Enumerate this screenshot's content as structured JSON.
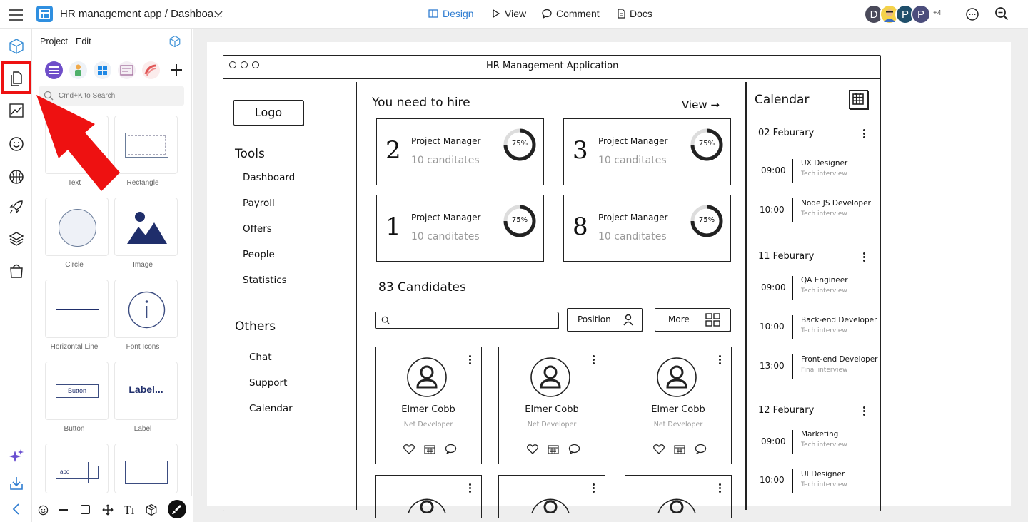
{
  "topbar": {
    "title": "HR management app / Dashboa...",
    "nav": {
      "design": "Design",
      "view": "View",
      "comment": "Comment",
      "docs": "Docs"
    },
    "avatars": [
      "D",
      "P",
      "P"
    ],
    "avatar_more": "+4",
    "accent": "#2f7dd1"
  },
  "panel": {
    "menu": {
      "project": "Project",
      "edit": "Edit"
    },
    "search_placeholder": "Cmd+K to Search",
    "tiles": [
      "Text",
      "Rectangle",
      "Circle",
      "Image",
      "Horizontal Line",
      "Font Icons",
      "Button",
      "Label"
    ],
    "button_preview": "Button",
    "label_preview": "Label...",
    "input_preview": "abc"
  },
  "mockup": {
    "window_title": "HR Management Application",
    "logo": "Logo",
    "tools_heading": "Tools",
    "tools": [
      "Dashboard",
      "Payroll",
      "Offers",
      "People",
      "Statistics"
    ],
    "others_heading": "Others",
    "others": [
      "Chat",
      "Support",
      "Calendar"
    ],
    "hire_heading": "You need to hire",
    "view_link": "View →",
    "hire_cards": [
      {
        "count": "2",
        "role": "Project Manager",
        "candidates": "10 canditates",
        "percent": "75%"
      },
      {
        "count": "3",
        "role": "Project Manager",
        "candidates": "10 canditates",
        "percent": "75%"
      },
      {
        "count": "1",
        "role": "Project Manager",
        "candidates": "10 canditates",
        "percent": "75%"
      },
      {
        "count": "8",
        "role": "Project Manager",
        "candidates": "10 canditates",
        "percent": "75%"
      }
    ],
    "candidates_heading": "83 Candidates",
    "position_button": "Position",
    "more_button": "More",
    "candidates": [
      {
        "name": "Elmer Cobb",
        "role": "Net Developer"
      },
      {
        "name": "Elmer Cobb",
        "role": "Net Developer"
      },
      {
        "name": "Elmer Cobb",
        "role": "Net Developer"
      }
    ],
    "calendar": {
      "heading": "Calendar",
      "days": [
        {
          "date": "02 Feburary",
          "events": [
            {
              "time": "09:00",
              "title": "UX Designer",
              "type": "Tech interview"
            },
            {
              "time": "10:00",
              "title": "Node JS Developer",
              "type": "Tech interview"
            }
          ]
        },
        {
          "date": "11 Feburary",
          "events": [
            {
              "time": "09:00",
              "title": "QA Engineer",
              "type": "Tech interview"
            },
            {
              "time": "10:00",
              "title": "Back-end Developer",
              "type": "Tech interview"
            },
            {
              "time": "13:00",
              "title": "Front-end Developer",
              "type": "Final interview"
            }
          ]
        },
        {
          "date": "12 Feburary",
          "events": [
            {
              "time": "09:00",
              "title": "Marketing",
              "type": "Tech interview"
            },
            {
              "time": "10:00",
              "title": "UI Designer",
              "type": "Tech interview"
            }
          ]
        }
      ]
    }
  },
  "annotation": {
    "color": "#ee1111"
  }
}
